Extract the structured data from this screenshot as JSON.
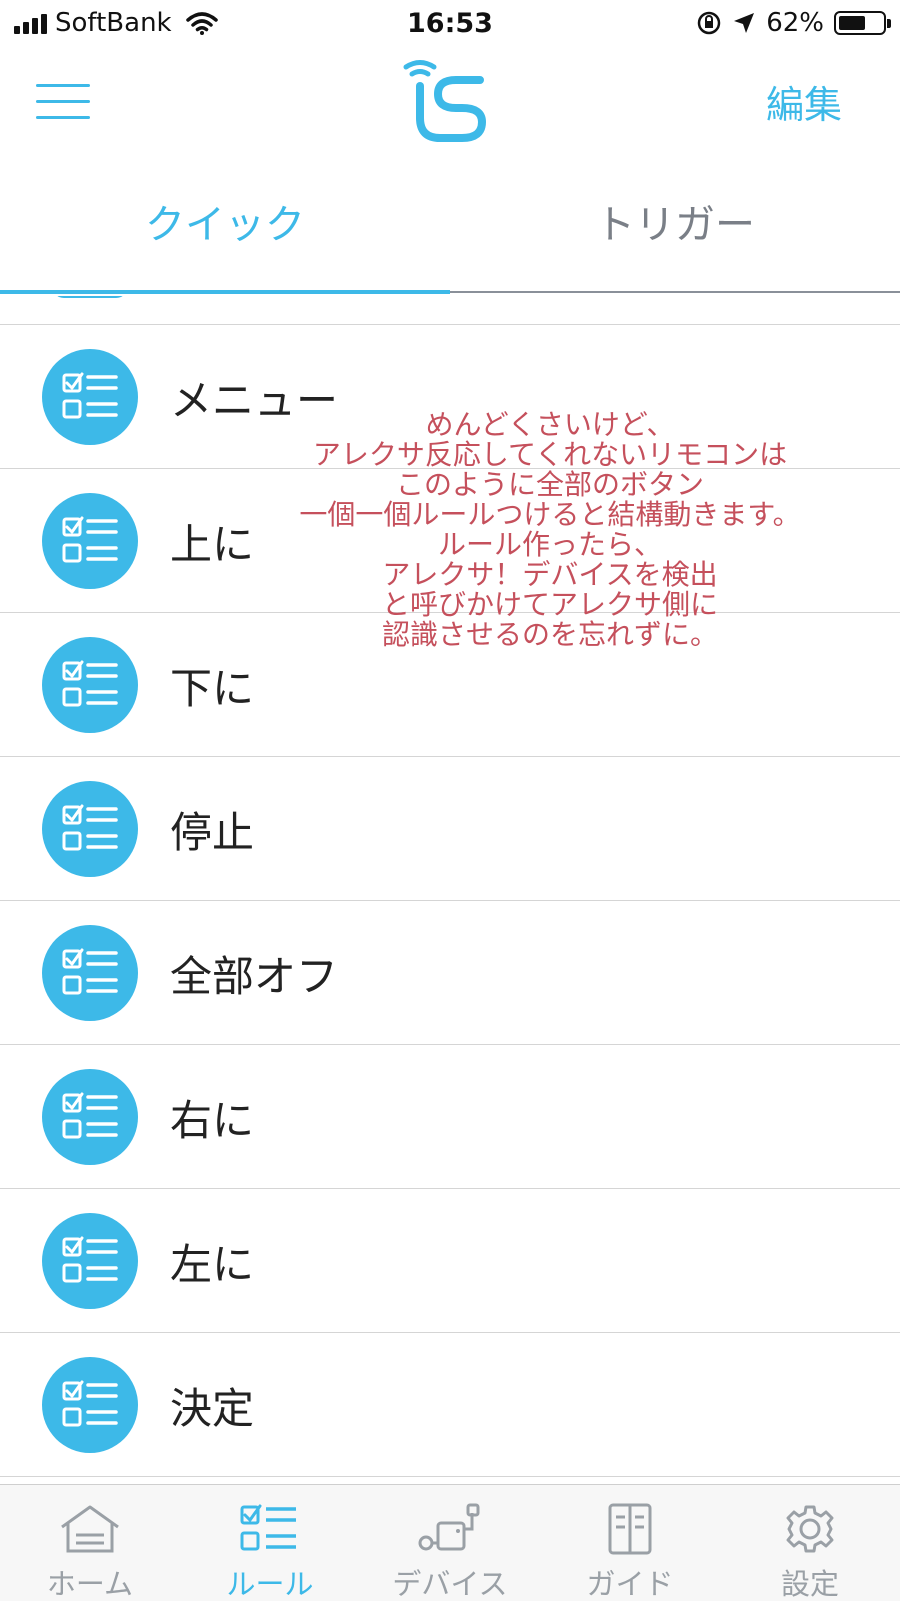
{
  "status_bar": {
    "carrier": "SoftBank",
    "time": "16:53",
    "battery": "62%",
    "battery_level": 0.62
  },
  "header": {
    "logo_text": "iS",
    "edit_label": "編集"
  },
  "tabs": [
    {
      "label": "クイック",
      "active": true
    },
    {
      "label": "トリガー",
      "active": false
    }
  ],
  "rules": [
    {
      "label": "メニュー"
    },
    {
      "label": "上に"
    },
    {
      "label": "下に"
    },
    {
      "label": "停止"
    },
    {
      "label": "全部オフ"
    },
    {
      "label": "右に"
    },
    {
      "label": "左に"
    },
    {
      "label": "決定"
    }
  ],
  "annotation": {
    "lines": [
      "めんどくさいけど、",
      "アレクサ反応してくれないリモコンは",
      "このように全部のボタン",
      "一個一個ルールつけると結構動きます。",
      "ルール作ったら、",
      "アレクサ！デバイスを検出",
      "と呼びかけてアレクサ側に",
      "認識させるのを忘れずに。"
    ],
    "color": "#c5505c"
  },
  "tab_bar": [
    {
      "label": "ホーム",
      "icon": "home-icon",
      "active": false
    },
    {
      "label": "ルール",
      "icon": "rule-icon",
      "active": true
    },
    {
      "label": "デバイス",
      "icon": "device-icon",
      "active": false
    },
    {
      "label": "ガイド",
      "icon": "guide-icon",
      "active": false
    },
    {
      "label": "設定",
      "icon": "gear-icon",
      "active": false
    }
  ],
  "colors": {
    "accent": "#3db9e8",
    "inactive": "#9aa0a6"
  }
}
